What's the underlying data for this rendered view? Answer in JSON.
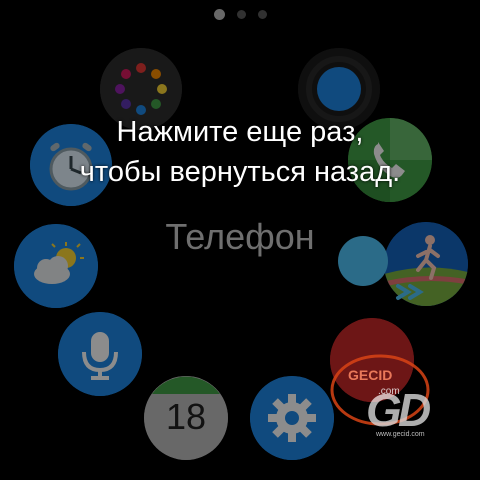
{
  "page_indicator": {
    "pages": 3,
    "active_index": 0
  },
  "toast": {
    "line1": "Нажмите еще раз,",
    "line2": "чтобы вернуться назад."
  },
  "focused_app": {
    "label": "Телефон"
  },
  "apps": [
    {
      "name": "apps-grid",
      "icon": "app-grid-icon",
      "color": "#3a3a3a"
    },
    {
      "name": "bluetooth-dot",
      "icon": "blue-circle-icon",
      "color": "#1e88e5"
    },
    {
      "name": "alarm",
      "icon": "alarm-clock-icon",
      "color": "#1e88e5"
    },
    {
      "name": "phone",
      "icon": "phone-icon",
      "color": "#43a047"
    },
    {
      "name": "weather",
      "icon": "weather-icon",
      "color": "#1e88e5"
    },
    {
      "name": "s-health",
      "icon": "runner-icon",
      "color": "#1565c0"
    },
    {
      "name": "s-voice",
      "icon": "microphone-icon",
      "color": "#1e88e5"
    },
    {
      "name": "calendar",
      "icon": "calendar-icon",
      "color": "#43a047",
      "date": "18"
    },
    {
      "name": "settings",
      "icon": "gear-icon",
      "color": "#1e88e5"
    },
    {
      "name": "music",
      "icon": "red-app-icon",
      "color": "#c62828"
    }
  ],
  "watermark": {
    "text_top": "GECID",
    "text_mid": ".com",
    "text_small": "www.gecid.com"
  },
  "colors": {
    "background": "#000000",
    "toast_text": "#ffffff",
    "label_text": "#6f6f6f",
    "accent_cyan": "#4fc3f7"
  }
}
